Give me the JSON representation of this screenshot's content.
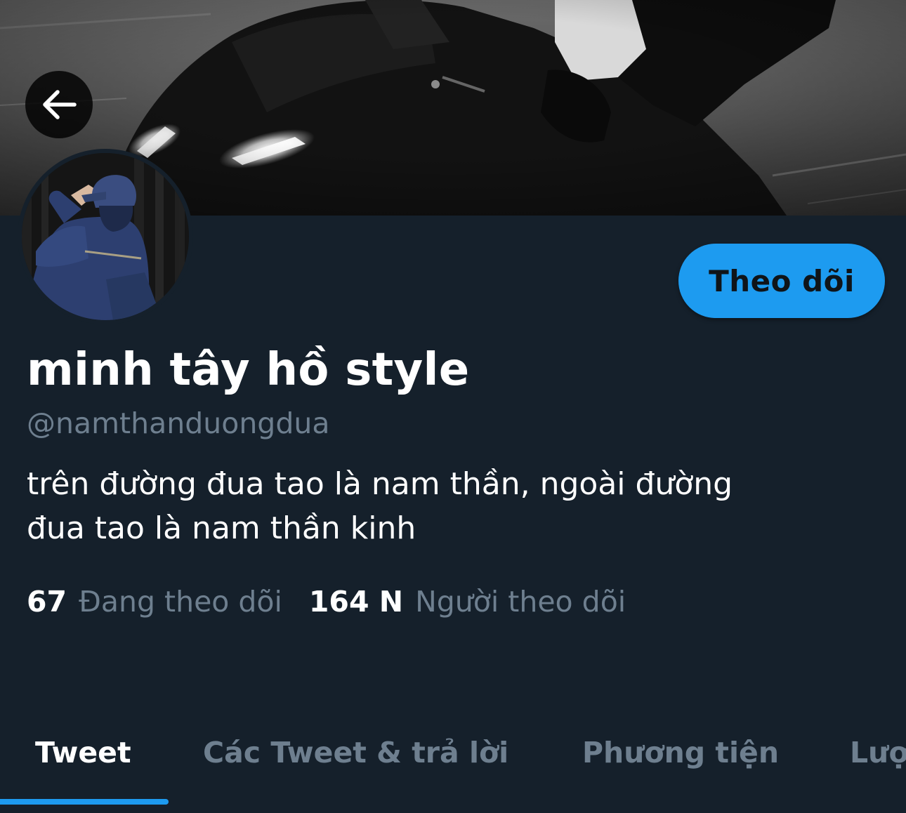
{
  "profile": {
    "display_name": "minh tây hồ style",
    "handle": "@namthanduongdua",
    "bio_lines": [
      "trên đường đua tao là nam thần, ngoài đường",
      "đua tao là nam thần kinh"
    ]
  },
  "actions": {
    "follow_label": "Theo dõi"
  },
  "stats": {
    "following_count": "67",
    "following_label": "Đang theo dõi",
    "followers_count": "164 N",
    "followers_label": "Người theo dõi"
  },
  "tabs": [
    {
      "label": "Tweet",
      "active": true
    },
    {
      "label": "Các Tweet & trả lời",
      "active": false
    },
    {
      "label": "Phương tiện",
      "active": false
    },
    {
      "label": "Lượt thích",
      "active": false
    }
  ],
  "colors": {
    "background": "#15202b",
    "accent": "#1d9bf0",
    "secondary_text": "#6e7f8f",
    "primary_text": "#ffffff"
  },
  "icons": {
    "back": "arrow-left-icon"
  }
}
